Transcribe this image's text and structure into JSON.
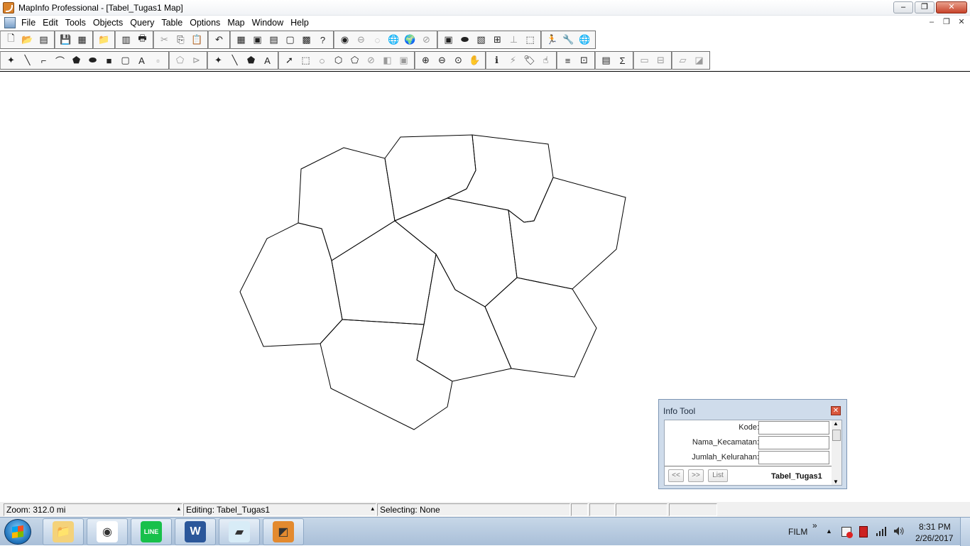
{
  "window": {
    "title": "MapInfo Professional - [Tabel_Tugas1 Map]",
    "controls": {
      "minimize": "‒",
      "maximize": "❐",
      "close": "✕"
    }
  },
  "menubar": {
    "items": [
      "File",
      "Edit",
      "Tools",
      "Objects",
      "Query",
      "Table",
      "Options",
      "Map",
      "Window",
      "Help"
    ],
    "doc_controls": {
      "minimize": "–",
      "restore": "❐",
      "close": "✕"
    }
  },
  "toolbar1": {
    "groups": [
      [
        {
          "name": "new-table-icon",
          "glyph": "🗋"
        },
        {
          "name": "open-table-icon",
          "glyph": "📂"
        },
        {
          "name": "open-dbms-icon",
          "glyph": "▤"
        }
      ],
      [
        {
          "name": "save-table-icon",
          "glyph": "💾"
        },
        {
          "name": "save-query-icon",
          "glyph": "▦"
        }
      ],
      [
        {
          "name": "open-workspace-icon",
          "glyph": "📁"
        }
      ],
      [
        {
          "name": "page-setup-icon",
          "glyph": "▥"
        },
        {
          "name": "print-icon",
          "glyph": "🖶"
        }
      ],
      [
        {
          "name": "cut-icon",
          "glyph": "✂",
          "disabled": true
        },
        {
          "name": "copy-icon",
          "glyph": "⎘"
        },
        {
          "name": "paste-icon",
          "glyph": "📋",
          "disabled": true
        }
      ],
      [
        {
          "name": "undo-icon",
          "glyph": "↶"
        }
      ],
      [
        {
          "name": "new-browser-icon",
          "glyph": "▦"
        },
        {
          "name": "new-mapper-icon",
          "glyph": "▣"
        },
        {
          "name": "new-grapher-icon",
          "glyph": "▤"
        },
        {
          "name": "new-layout-icon",
          "glyph": "▢"
        },
        {
          "name": "new-redistrict-icon",
          "glyph": "▩"
        },
        {
          "name": "help-icon",
          "glyph": "?"
        }
      ],
      [
        {
          "name": "catalog-icon",
          "glyph": "◉"
        },
        {
          "name": "stop-sign-icon",
          "glyph": "⊖",
          "disabled": true
        },
        {
          "name": "layer-disabled-icon",
          "glyph": "◌",
          "disabled": true
        },
        {
          "name": "globe-icon",
          "glyph": "🌐"
        },
        {
          "name": "earth-check-icon",
          "glyph": "🌍"
        },
        {
          "name": "null-icon",
          "glyph": "⊘",
          "disabled": true
        }
      ],
      [
        {
          "name": "map-window-icon",
          "glyph": "▣"
        },
        {
          "name": "geocode-icon",
          "glyph": "⬬"
        },
        {
          "name": "image-icon",
          "glyph": "▧"
        },
        {
          "name": "grid-icon",
          "glyph": "⊞"
        },
        {
          "name": "ruler-icon",
          "glyph": "⊥",
          "disabled": true
        },
        {
          "name": "window-select-icon",
          "glyph": "⬚"
        }
      ],
      [
        {
          "name": "run-icon",
          "glyph": "🏃"
        },
        {
          "name": "tool-manager-icon",
          "glyph": "🔧"
        },
        {
          "name": "world-icon",
          "glyph": "🌐"
        }
      ]
    ]
  },
  "toolbar2": {
    "groups": [
      [
        {
          "name": "symbol-icon",
          "glyph": "✦"
        },
        {
          "name": "line-icon",
          "glyph": "╲"
        },
        {
          "name": "polyline-icon",
          "glyph": "⌐"
        },
        {
          "name": "arc-icon",
          "glyph": "⌒"
        },
        {
          "name": "polygon-icon",
          "glyph": "⬟"
        },
        {
          "name": "ellipse-icon",
          "glyph": "⬬"
        },
        {
          "name": "rectangle-icon",
          "glyph": "■"
        },
        {
          "name": "rounded-rectangle-icon",
          "glyph": "▢"
        },
        {
          "name": "text-icon",
          "glyph": "A"
        },
        {
          "name": "frame-icon",
          "glyph": "▫",
          "disabled": true
        }
      ],
      [
        {
          "name": "reshape-icon",
          "glyph": "⬠",
          "disabled": true
        },
        {
          "name": "add-node-icon",
          "glyph": "⊳",
          "disabled": true
        }
      ],
      [
        {
          "name": "symbol-style-icon",
          "glyph": "✦"
        },
        {
          "name": "line-style-icon",
          "glyph": "╲"
        },
        {
          "name": "region-style-icon",
          "glyph": "⬟"
        },
        {
          "name": "text-style-icon",
          "glyph": "A"
        }
      ],
      [
        {
          "name": "select-arrow-icon",
          "glyph": "➚"
        },
        {
          "name": "marquee-select-icon",
          "glyph": "⬚"
        },
        {
          "name": "radius-select-icon",
          "glyph": "◌"
        },
        {
          "name": "polygon-select-icon",
          "glyph": "⬡"
        },
        {
          "name": "boundary-select-icon",
          "glyph": "⬠"
        },
        {
          "name": "unselect-all-icon",
          "glyph": "⊘",
          "disabled": true
        },
        {
          "name": "invert-selection-icon",
          "glyph": "◧",
          "disabled": true
        },
        {
          "name": "graph-select-icon",
          "glyph": "▣",
          "disabled": true
        }
      ],
      [
        {
          "name": "zoom-in-icon",
          "glyph": "⊕"
        },
        {
          "name": "zoom-out-icon",
          "glyph": "⊖"
        },
        {
          "name": "change-view-icon",
          "glyph": "⊙"
        },
        {
          "name": "grabber-hand-icon",
          "glyph": "✋"
        }
      ],
      [
        {
          "name": "info-tool-icon",
          "glyph": "ℹ"
        },
        {
          "name": "hotlink-icon",
          "glyph": "⚡",
          "disabled": true
        },
        {
          "name": "label-tool-icon",
          "glyph": "🏷"
        },
        {
          "name": "drag-map-icon",
          "glyph": "☝"
        }
      ],
      [
        {
          "name": "layer-control-icon",
          "glyph": "≡"
        },
        {
          "name": "ruler-tool-icon",
          "glyph": "⊡"
        }
      ],
      [
        {
          "name": "legend-icon",
          "glyph": "▤"
        },
        {
          "name": "statistics-icon",
          "glyph": "Σ"
        }
      ],
      [
        {
          "name": "clip-region-icon",
          "glyph": "▭",
          "disabled": true
        },
        {
          "name": "set-target-icon",
          "glyph": "⊟",
          "disabled": true
        }
      ],
      [
        {
          "name": "scale-bar-icon",
          "glyph": "▱",
          "disabled": true
        },
        {
          "name": "ruler-disabled-icon",
          "glyph": "◪",
          "disabled": true
        }
      ]
    ]
  },
  "map": {
    "stroke_color": "#000000",
    "regions": [
      "484,208 542,223 556,311 467,367 453,322 420,314 424,238",
      "542,223 564,193 665,190 670,240 657,266 630,279 556,311",
      "665,190 772,203 779,250 752,311 738,313 716,296 630,279 657,266 670,240",
      "779,250 881,278 868,351 806,407 728,391 716,296 738,313 752,311",
      "556,311 630,279 716,296 728,391 683,432 641,408 614,358",
      "420,314 453,322 467,367 482,450 451,484 371,488 338,411 376,336",
      "467,367 556,311 614,358 597,457 482,450",
      "614,358 641,408 683,432 720,519 637,537 587,507 597,457",
      "683,432 728,391 806,407 840,462 809,531 720,519",
      "482,450 597,457 587,507 637,537 630,573 583,605 466,547 451,484"
    ]
  },
  "info_tool": {
    "title": "Info Tool",
    "close": "✕",
    "fields": [
      {
        "label": "Kode:",
        "value": ""
      },
      {
        "label": "Nama_Kecamatan:",
        "value": ""
      },
      {
        "label": "Jumlah_Kelurahan:",
        "value": ""
      }
    ],
    "prev_label": "<<",
    "next_label": ">>",
    "list_label": "List",
    "table_name": "Tabel_Tugas1",
    "scroll_up": "▲",
    "scroll_down": "▼"
  },
  "statusbar": {
    "zoom": "Zoom: 312.0 mi",
    "editing": "Editing: Tabel_Tugas1",
    "selecting": "Selecting: None",
    "caret": "▴"
  },
  "taskbar": {
    "apps": [
      {
        "name": "windows-explorer-taskbar-icon",
        "glyph": "📁"
      },
      {
        "name": "chrome-taskbar-icon",
        "glyph": "◉"
      },
      {
        "name": "line-taskbar-icon",
        "glyph": "LINE"
      },
      {
        "name": "word-taskbar-icon",
        "glyph": "W"
      },
      {
        "name": "notepad-taskbar-icon",
        "glyph": "▰"
      },
      {
        "name": "mapinfo-taskbar-icon",
        "glyph": "◩"
      }
    ],
    "tray_label": "FILM",
    "tray_expand": "»",
    "tray_show_hidden": "▲",
    "time": "8:31 PM",
    "date": "2/26/2017"
  }
}
